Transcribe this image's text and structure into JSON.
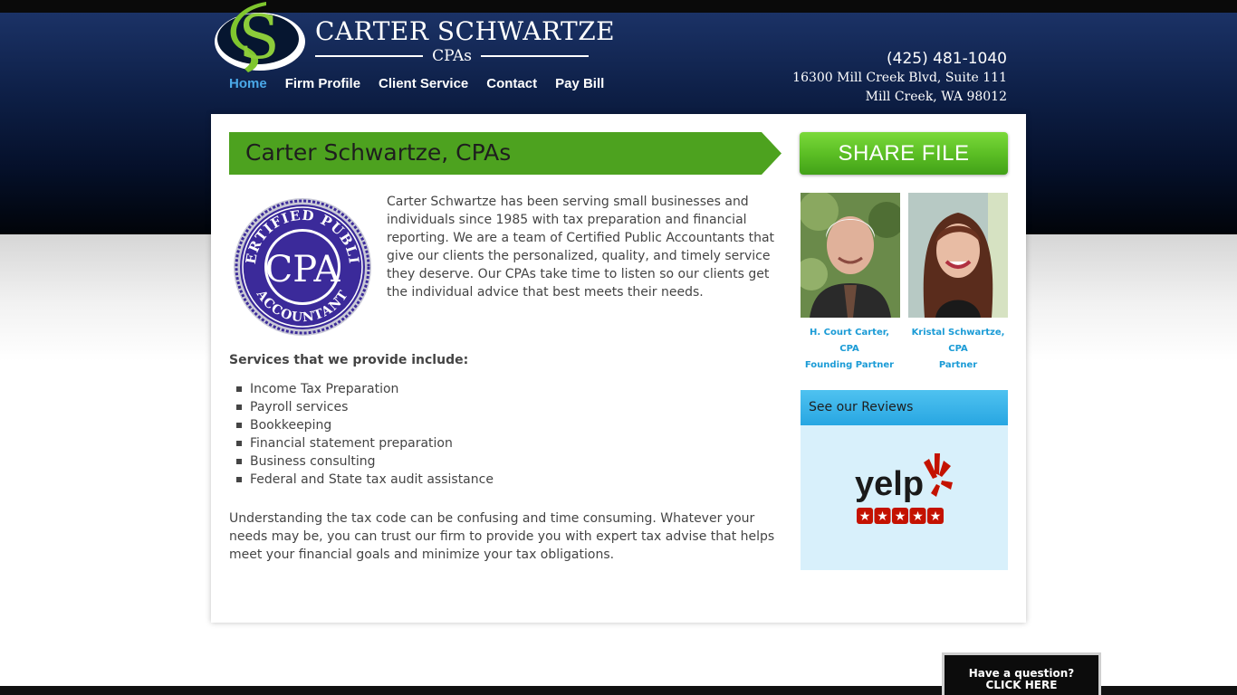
{
  "header": {
    "logo_mark": "S",
    "brand_name": "CARTER SCHWARTZE",
    "brand_sub": "CPAs",
    "phone": "(425) 481-1040",
    "address_line1": "16300 Mill Creek Blvd, Suite 111",
    "address_line2": "Mill Creek, WA 98012"
  },
  "nav": {
    "items": [
      {
        "label": "Home",
        "active": true
      },
      {
        "label": "Firm Profile"
      },
      {
        "label": "Client Service"
      },
      {
        "label": "Contact"
      },
      {
        "label": "Pay Bill"
      }
    ]
  },
  "main": {
    "title": "Carter Schwartze, CPAs",
    "seal": {
      "top_text": "CERTIFIED PUBLIC",
      "center_text": "CPA",
      "bottom_text": "ACCOUNTANT"
    },
    "intro": "Carter Schwartze has been serving small businesses and individuals since 1985 with tax preparation and financial reporting. We are a team of Certified Public Accountants that give our clients the personalized, quality, and timely service they deserve. Our CPAs take time to listen so our clients get the individual advice that best meets their needs.",
    "services_heading": "Services that we provide include:",
    "services": [
      "Income Tax Preparation",
      "Payroll services",
      "Bookkeeping",
      "Financial statement preparation",
      "Business consulting",
      "Federal and State tax audit assistance"
    ],
    "closing": "Understanding the tax code can be confusing and time consuming. Whatever your needs may be, you can trust our firm to provide you with expert tax advise that helps meet your financial goals and minimize your tax obligations."
  },
  "sidebar": {
    "share_label": "SHARE FILE",
    "people": [
      {
        "name_line1": "H. Court Carter,",
        "name_line2": "CPA",
        "role": "Founding Partner"
      },
      {
        "name_line1": "Kristal Schwartze,",
        "name_line2": "CPA",
        "role": "Partner"
      }
    ],
    "reviews_label": "See our Reviews",
    "yelp_text": "yelp",
    "rating_stars": 5
  },
  "question": {
    "line1": "Have a question?",
    "line2": "CLICK HERE"
  },
  "colors": {
    "accent_green": "#4da21f",
    "link_blue": "#1a9bd6",
    "nav_active": "#4aa8e8",
    "header_navy": "#0e2048",
    "yelp_red": "#c41200"
  }
}
